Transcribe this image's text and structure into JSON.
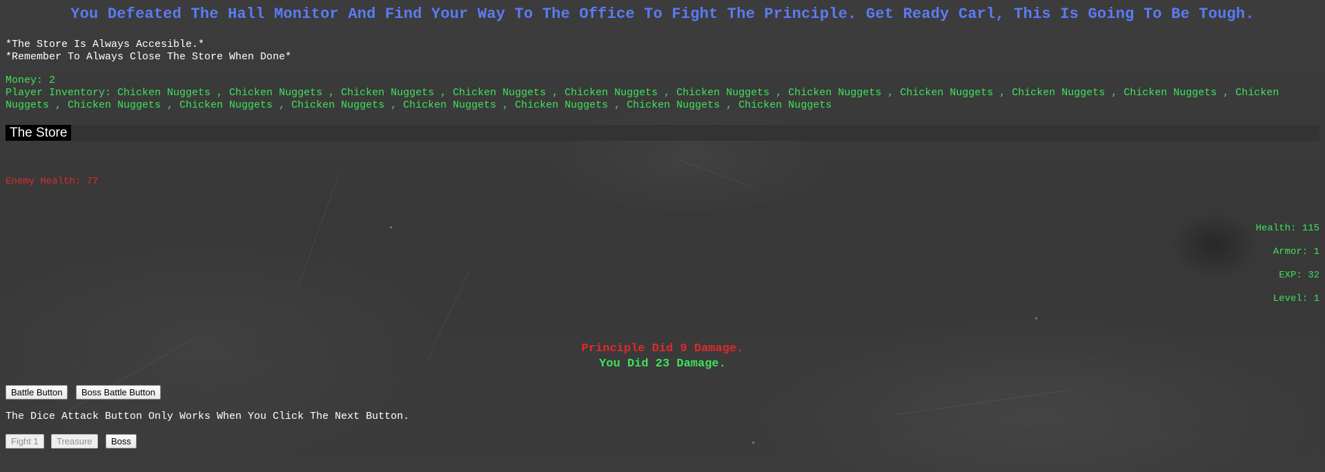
{
  "header": {
    "title": "You Defeated The Hall Monitor And Find Your Way To The Office To Fight The Principle. Get Ready Carl, This Is Going To Be Tough."
  },
  "notes": {
    "store_accessible": "*The Store Is Always Accesible.*",
    "close_store": "*Remember To Always Close The Store When Done*"
  },
  "player": {
    "money_label": "Money: 2",
    "inventory_label": "Player Inventory:",
    "inventory_items": [
      "Chicken Nuggets",
      "Chicken Nuggets",
      "Chicken Nuggets",
      "Chicken Nuggets",
      "Chicken Nuggets",
      "Chicken Nuggets",
      "Chicken Nuggets",
      "Chicken Nuggets",
      "Chicken Nuggets",
      "Chicken Nuggets",
      "Chicken Nuggets",
      "Chicken Nuggets",
      "Chicken Nuggets",
      "Chicken Nuggets",
      "Chicken Nuggets",
      "Chicken Nuggets",
      "Chicken Nuggets",
      "Chicken Nuggets"
    ],
    "inventory_text": "Player Inventory: Chicken Nuggets , Chicken Nuggets , Chicken Nuggets , Chicken Nuggets , Chicken Nuggets , Chicken Nuggets , Chicken Nuggets , Chicken Nuggets , Chicken Nuggets , Chicken Nuggets , Chicken Nuggets , Chicken Nuggets , Chicken Nuggets , Chicken Nuggets , Chicken Nuggets , Chicken Nuggets , Chicken Nuggets , Chicken Nuggets"
  },
  "store": {
    "button_label": "The Store"
  },
  "enemy": {
    "health_label": "Enemy Health: 77"
  },
  "stats": {
    "health": "Health: 115",
    "armor": "Armor: 1",
    "exp": "EXP: 32",
    "level": "Level: 1"
  },
  "battle_log": {
    "enemy_damage": "Principle Did 9 Damage.",
    "player_damage": "You Did 23 Damage."
  },
  "controls": {
    "battle_button": "Battle Button",
    "boss_battle_button": "Boss Battle Button",
    "hint": "The Dice Attack Button Only Works When You Click The Next Button.",
    "fight_button": "Fight 1",
    "treasure_button": "Treasure",
    "boss_button": "Boss"
  },
  "colors": {
    "title_blue": "#5b7bf5",
    "stat_green": "#3ee25b",
    "enemy_red": "#e02a2a",
    "store_bar": "#333333"
  }
}
